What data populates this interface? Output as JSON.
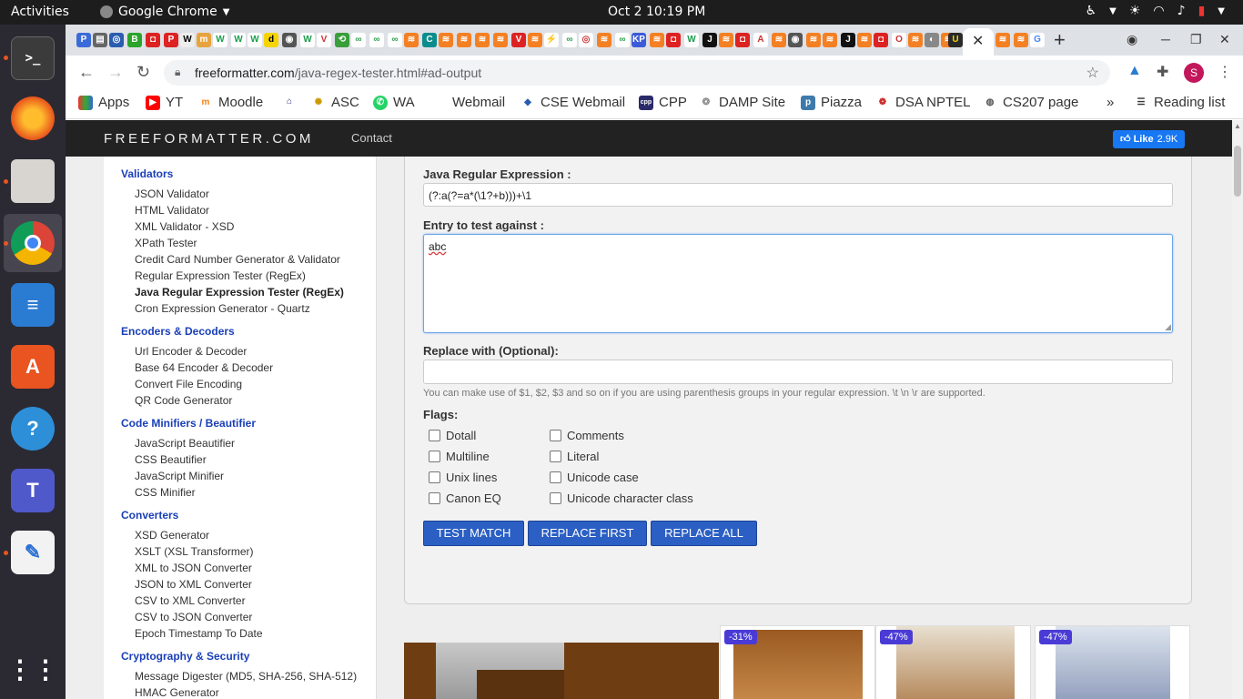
{
  "topbar": {
    "activities": "Activities",
    "app_name": "Google Chrome",
    "clock": "Oct 2  10:19 PM"
  },
  "browser": {
    "url_host": "freeformatter.com",
    "url_path": "/java-regex-tester.html#ad-output",
    "avatar_letter": "S"
  },
  "bookmarks": [
    {
      "label": "Apps",
      "icon": "apps-grid-icon"
    },
    {
      "label": "YT",
      "icon": "youtube-icon"
    },
    {
      "label": "Moodle",
      "icon": "moodle-icon"
    },
    {
      "label": "",
      "icon": "institute-icon"
    },
    {
      "label": "ASC",
      "icon": "asc-icon"
    },
    {
      "label": "WA",
      "icon": "whatsapp-icon"
    },
    {
      "label": "Webmail",
      "icon": ""
    },
    {
      "label": "CSE Webmail",
      "icon": "cse-webmail-icon"
    },
    {
      "label": "CPP",
      "icon": "cpp-icon"
    },
    {
      "label": "DAMP Site",
      "icon": "damp-icon"
    },
    {
      "label": "Piazza",
      "icon": "piazza-icon"
    },
    {
      "label": "DSA NPTEL",
      "icon": "nptel-icon"
    },
    {
      "label": "CS207 page",
      "icon": "globe-icon"
    }
  ],
  "bookmarks_more": "»",
  "reading_list": "Reading list",
  "site": {
    "logo": "FREEFORMATTER.COM",
    "contact": "Contact",
    "fb_like": "Like",
    "fb_count": "2.9K"
  },
  "sidebar": {
    "validators": {
      "title": "Validators",
      "items": [
        "JSON Validator",
        "HTML Validator",
        "XML Validator - XSD",
        "XPath Tester",
        "Credit Card Number Generator & Validator",
        "Regular Expression Tester (RegEx)",
        "Java Regular Expression Tester (RegEx)",
        "Cron Expression Generator - Quartz"
      ]
    },
    "encoders": {
      "title": "Encoders & Decoders",
      "items": [
        "Url Encoder & Decoder",
        "Base 64 Encoder & Decoder",
        "Convert File Encoding",
        "QR Code Generator"
      ]
    },
    "minifiers": {
      "title": "Code Minifiers / Beautifier",
      "items": [
        "JavaScript Beautifier",
        "CSS Beautifier",
        "JavaScript Minifier",
        "CSS Minifier"
      ]
    },
    "converters": {
      "title": "Converters",
      "items": [
        "XSD Generator",
        "XSLT (XSL Transformer)",
        "XML to JSON Converter",
        "JSON to XML Converter",
        "CSV to XML Converter",
        "CSV to JSON Converter",
        "Epoch Timestamp To Date"
      ]
    },
    "crypto": {
      "title": "Cryptography & Security",
      "items": [
        "Message Digester (MD5, SHA-256, SHA-512)",
        "HMAC Generator"
      ]
    }
  },
  "form": {
    "regex_label": "Java Regular Expression :",
    "regex_value": "(?:a(?=a*(\\1?+b)))+\\1",
    "entry_label": "Entry to test against :",
    "entry_value": "abc",
    "replace_label": "Replace with (Optional):",
    "replace_value": "",
    "hint": "You can make use of $1, $2, $3 and so on if you are using parenthesis groups in your regular expression. \\t \\n \\r are supported.",
    "flags_label": "Flags:",
    "flags": [
      "Dotall",
      "Multiline",
      "Unix lines",
      "Canon EQ",
      "Comments",
      "Literal",
      "Unicode case",
      "Unicode character class"
    ],
    "btn_test": "TEST MATCH",
    "btn_replace_first": "REPLACE FIRST",
    "btn_replace_all": "REPLACE ALL"
  },
  "ads": {
    "badges": [
      "-31%",
      "-47%",
      "-47%"
    ]
  }
}
